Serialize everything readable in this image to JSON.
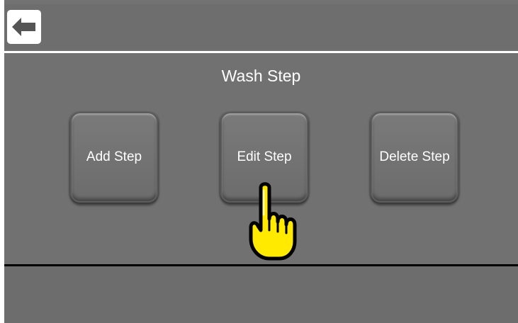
{
  "header": {
    "back_icon": "back-arrow-icon"
  },
  "panel": {
    "title": "Wash Step",
    "buttons": [
      {
        "label": "Add Step"
      },
      {
        "label": "Edit Step"
      },
      {
        "label": "Delete Step"
      }
    ]
  },
  "overlay": {
    "pointer_icon": "pointing-hand-icon",
    "pointer_color": "#ffea00"
  },
  "colors": {
    "background": "#717171",
    "header_line": "#ffffff",
    "divider": "#000000"
  }
}
